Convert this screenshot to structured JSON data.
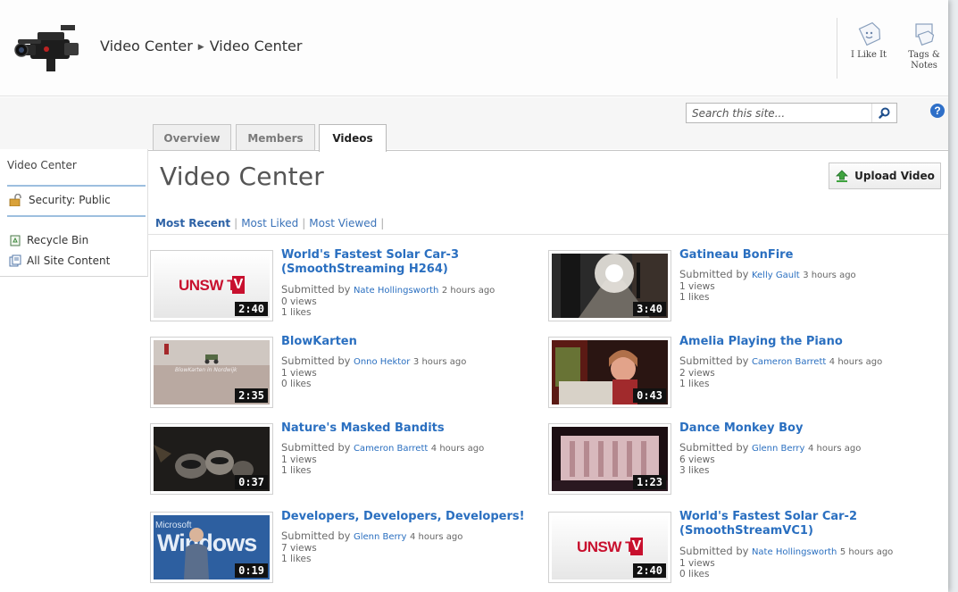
{
  "header": {
    "crumb_site": "Video Center",
    "crumb_page": "Video Center",
    "like_label": "I Like It",
    "tags_label_1": "Tags &",
    "tags_label_2": "Notes"
  },
  "search": {
    "placeholder": "Search this site..."
  },
  "tabs": [
    {
      "label": "Overview"
    },
    {
      "label": "Members"
    },
    {
      "label": "Videos"
    }
  ],
  "leftnav": {
    "title": "Video Center",
    "security": "Security: Public",
    "recycle": "Recycle Bin",
    "all_content": "All Site Content"
  },
  "main": {
    "title": "Video Center",
    "upload_label": "Upload Video",
    "filters": [
      "Most Recent",
      "Most Liked",
      "Most Viewed"
    ]
  },
  "videos": [
    {
      "title_1": "World's Fastest Solar Car-3",
      "title_2": "(SmoothStreaming H264)",
      "by": "Submitted by",
      "user": "Nate Hollingsworth",
      "when": "2 hours ago",
      "views": "0 views",
      "likes": "1 likes",
      "duration": "2:40",
      "thumb": "unsw"
    },
    {
      "title_1": "Gatineau BonFire",
      "title_2": "",
      "by": "Submitted by",
      "user": "Kelly Gault",
      "when": "3 hours ago",
      "views": "1 views",
      "likes": "1 likes",
      "duration": "3:40",
      "thumb": "street"
    },
    {
      "title_1": "BlowKarten",
      "title_2": "",
      "by": "Submitted by",
      "user": "Onno Hektor",
      "when": "3 hours ago",
      "views": "1 views",
      "likes": "0 likes",
      "duration": "2:35",
      "thumb": "beach"
    },
    {
      "title_1": "Amelia Playing the Piano",
      "title_2": "",
      "by": "Submitted by",
      "user": "Cameron Barrett",
      "when": "4 hours ago",
      "views": "2 views",
      "likes": "1 likes",
      "duration": "0:43",
      "thumb": "piano"
    },
    {
      "title_1": "Nature's Masked Bandits",
      "title_2": "",
      "by": "Submitted by",
      "user": "Cameron Barrett",
      "when": "4 hours ago",
      "views": "1 views",
      "likes": "1 likes",
      "duration": "0:37",
      "thumb": "raccoon"
    },
    {
      "title_1": "Dance Monkey Boy",
      "title_2": "",
      "by": "Submitted by",
      "user": "Glenn Berry",
      "when": "4 hours ago",
      "views": "6 views",
      "likes": "3 likes",
      "duration": "1:23",
      "thumb": "stage"
    },
    {
      "title_1": "Developers, Developers, Developers!",
      "title_2": "",
      "by": "Submitted by",
      "user": "Glenn Berry",
      "when": "4 hours ago",
      "views": "7 views",
      "likes": "1 likes",
      "duration": "0:19",
      "thumb": "windows"
    },
    {
      "title_1": "World's Fastest Solar Car-2",
      "title_2": "(SmoothStreamVC1)",
      "by": "Submitted by",
      "user": "Nate Hollingsworth",
      "when": "5 hours ago",
      "views": "1 views",
      "likes": "0 likes",
      "duration": "2:40",
      "thumb": "unsw"
    }
  ],
  "thumb_text": {
    "unsw_1": "UNSW T",
    "unsw_2": "V",
    "beach_caption": "BlowKarten in Nordwijk",
    "windows_1": "Microsoft",
    "windows_2": "Windows"
  },
  "colors": {
    "link": "#2a6fc0",
    "accent_red": "#c8102e",
    "help": "#2e6fc8"
  }
}
